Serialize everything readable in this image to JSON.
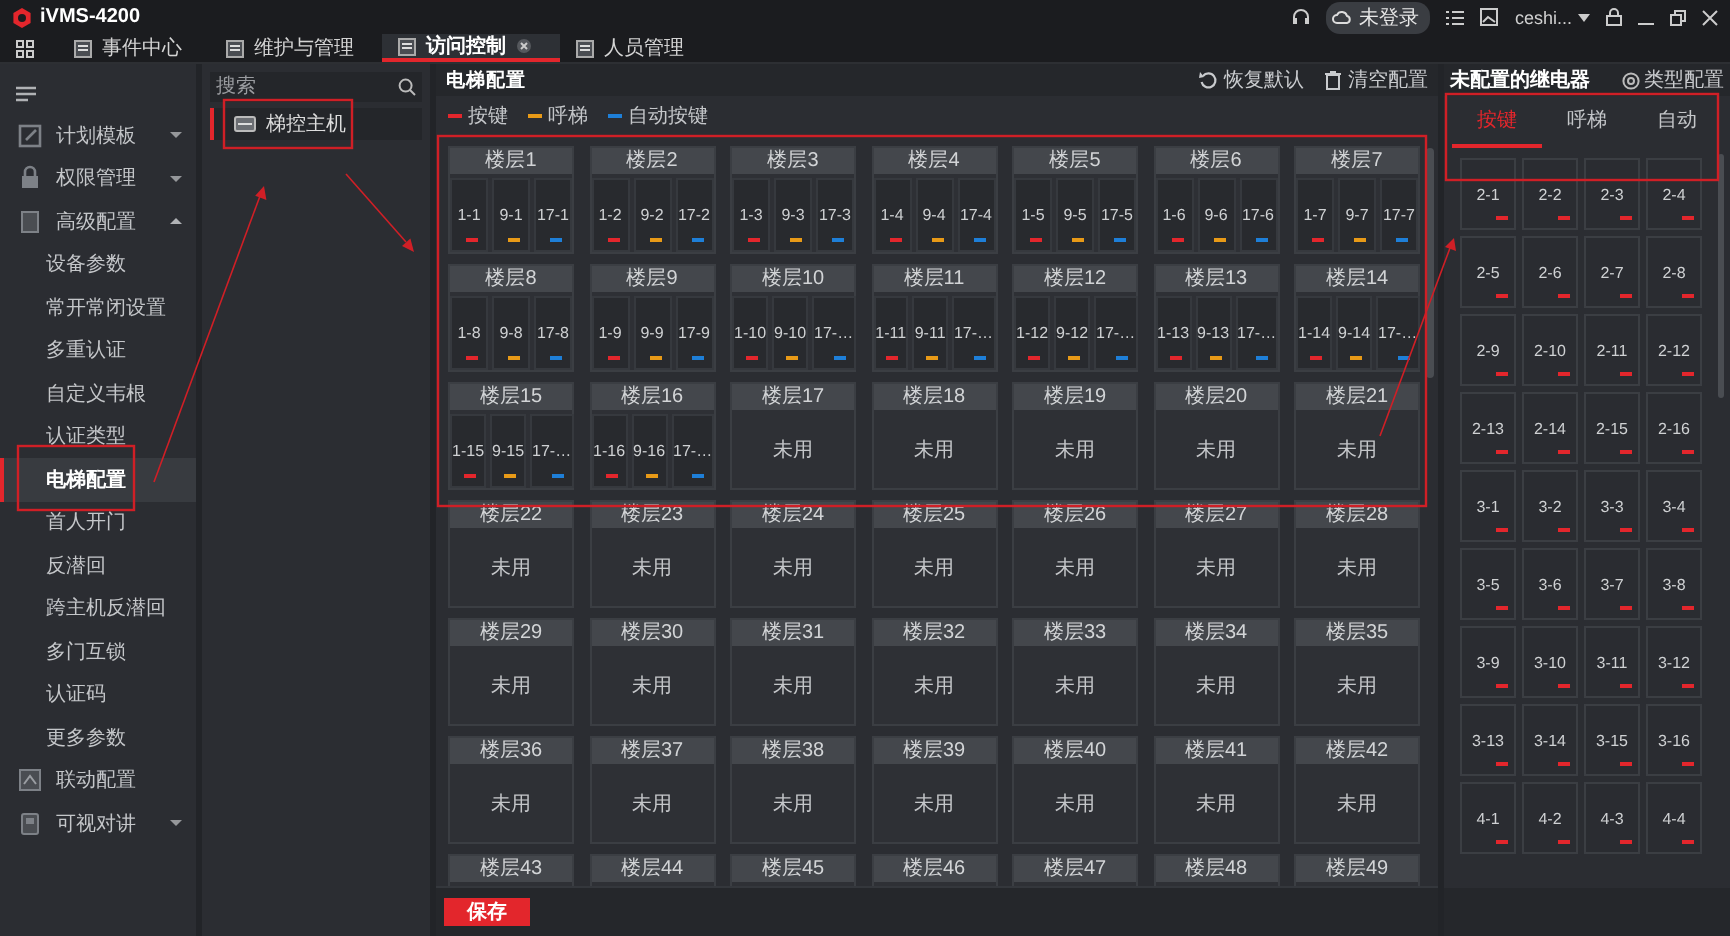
{
  "app": {
    "title": "iVMS-4200"
  },
  "title_bar": {
    "login_status": "未登录",
    "user": "ceshi..."
  },
  "nav_tabs": [
    {
      "label": "事件中心",
      "selected": false,
      "closable": false
    },
    {
      "label": "维护与管理",
      "selected": false,
      "closable": false
    },
    {
      "label": "访问控制",
      "selected": true,
      "closable": true
    },
    {
      "label": "人员管理",
      "selected": false,
      "closable": false
    }
  ],
  "sidebar": {
    "items": [
      {
        "label": "计划模板",
        "expanded": false
      },
      {
        "label": "权限管理",
        "expanded": false
      },
      {
        "label": "高级配置",
        "expanded": true,
        "children": [
          {
            "label": "设备参数",
            "selected": false
          },
          {
            "label": "常开常闭设置",
            "selected": false
          },
          {
            "label": "多重认证",
            "selected": false
          },
          {
            "label": "自定义韦根",
            "selected": false
          },
          {
            "label": "认证类型",
            "selected": false
          },
          {
            "label": "电梯配置",
            "selected": true
          },
          {
            "label": "首人开门",
            "selected": false
          },
          {
            "label": "反潜回",
            "selected": false
          },
          {
            "label": "跨主机反潜回",
            "selected": false
          },
          {
            "label": "多门互锁",
            "selected": false
          },
          {
            "label": "认证码",
            "selected": false
          },
          {
            "label": "更多参数",
            "selected": false
          }
        ]
      },
      {
        "label": "联动配置"
      },
      {
        "label": "可视对讲",
        "expanded": false
      }
    ]
  },
  "device_panel": {
    "search": {
      "placeholder": "搜索"
    },
    "devices": [
      {
        "label": "梯控主机",
        "selected": true
      }
    ]
  },
  "main": {
    "title": "电梯配置",
    "actions": [
      {
        "label": "恢复默认",
        "kind": "reset"
      },
      {
        "label": "清空配置",
        "kind": "clear"
      }
    ],
    "legend": [
      {
        "label": "按键",
        "color": "#e3262c"
      },
      {
        "label": "呼梯",
        "color": "#e89a17"
      },
      {
        "label": "自动按键",
        "color": "#1e7fd8"
      }
    ],
    "floors": [
      {
        "label": "楼层1",
        "units": [
          {
            "label": "1-1",
            "color": "#e3262c"
          },
          {
            "label": "9-1",
            "color": "#e89a17"
          },
          {
            "label": "17-1",
            "color": "#1e7fd8"
          }
        ]
      },
      {
        "label": "楼层2",
        "units": [
          {
            "label": "1-2",
            "color": "#e3262c"
          },
          {
            "label": "9-2",
            "color": "#e89a17"
          },
          {
            "label": "17-2",
            "color": "#1e7fd8"
          }
        ]
      },
      {
        "label": "楼层3",
        "units": [
          {
            "label": "1-3",
            "color": "#e3262c"
          },
          {
            "label": "9-3",
            "color": "#e89a17"
          },
          {
            "label": "17-3",
            "color": "#1e7fd8"
          }
        ]
      },
      {
        "label": "楼层4",
        "units": [
          {
            "label": "1-4",
            "color": "#e3262c"
          },
          {
            "label": "9-4",
            "color": "#e89a17"
          },
          {
            "label": "17-4",
            "color": "#1e7fd8"
          }
        ]
      },
      {
        "label": "楼层5",
        "units": [
          {
            "label": "1-5",
            "color": "#e3262c"
          },
          {
            "label": "9-5",
            "color": "#e89a17"
          },
          {
            "label": "17-5",
            "color": "#1e7fd8"
          }
        ]
      },
      {
        "label": "楼层6",
        "units": [
          {
            "label": "1-6",
            "color": "#e3262c"
          },
          {
            "label": "9-6",
            "color": "#e89a17"
          },
          {
            "label": "17-6",
            "color": "#1e7fd8"
          }
        ]
      },
      {
        "label": "楼层7",
        "units": [
          {
            "label": "1-7",
            "color": "#e3262c"
          },
          {
            "label": "9-7",
            "color": "#e89a17"
          },
          {
            "label": "17-7",
            "color": "#1e7fd8"
          }
        ]
      },
      {
        "label": "楼层8",
        "units": [
          {
            "label": "1-8",
            "color": "#e3262c"
          },
          {
            "label": "9-8",
            "color": "#e89a17"
          },
          {
            "label": "17-8",
            "color": "#1e7fd8"
          }
        ]
      },
      {
        "label": "楼层9",
        "units": [
          {
            "label": "1-9",
            "color": "#e3262c"
          },
          {
            "label": "9-9",
            "color": "#e89a17"
          },
          {
            "label": "17-9",
            "color": "#1e7fd8"
          }
        ]
      },
      {
        "label": "楼层10",
        "units": [
          {
            "label": "1-10",
            "color": "#e3262c"
          },
          {
            "label": "9-10",
            "color": "#e89a17"
          },
          {
            "label": "17-…",
            "color": "#1e7fd8"
          }
        ]
      },
      {
        "label": "楼层11",
        "units": [
          {
            "label": "1-11",
            "color": "#e3262c"
          },
          {
            "label": "9-11",
            "color": "#e89a17"
          },
          {
            "label": "17-…",
            "color": "#1e7fd8"
          }
        ]
      },
      {
        "label": "楼层12",
        "units": [
          {
            "label": "1-12",
            "color": "#e3262c"
          },
          {
            "label": "9-12",
            "color": "#e89a17"
          },
          {
            "label": "17-…",
            "color": "#1e7fd8"
          }
        ]
      },
      {
        "label": "楼层13",
        "units": [
          {
            "label": "1-13",
            "color": "#e3262c"
          },
          {
            "label": "9-13",
            "color": "#e89a17"
          },
          {
            "label": "17-…",
            "color": "#1e7fd8"
          }
        ]
      },
      {
        "label": "楼层14",
        "units": [
          {
            "label": "1-14",
            "color": "#e3262c"
          },
          {
            "label": "9-14",
            "color": "#e89a17"
          },
          {
            "label": "17-…",
            "color": "#1e7fd8"
          }
        ]
      },
      {
        "label": "楼层15",
        "units": [
          {
            "label": "1-15",
            "color": "#e3262c"
          },
          {
            "label": "9-15",
            "color": "#e89a17"
          },
          {
            "label": "17-…",
            "color": "#1e7fd8"
          }
        ]
      },
      {
        "label": "楼层16",
        "units": [
          {
            "label": "1-16",
            "color": "#e3262c"
          },
          {
            "label": "9-16",
            "color": "#e89a17"
          },
          {
            "label": "17-…",
            "color": "#1e7fd8"
          }
        ]
      },
      {
        "label": "楼层17",
        "status": "未用"
      },
      {
        "label": "楼层18",
        "status": "未用"
      },
      {
        "label": "楼层19",
        "status": "未用"
      },
      {
        "label": "楼层20",
        "status": "未用"
      },
      {
        "label": "楼层21",
        "status": "未用"
      },
      {
        "label": "楼层22",
        "status": "未用"
      },
      {
        "label": "楼层23",
        "status": "未用"
      },
      {
        "label": "楼层24",
        "status": "未用"
      },
      {
        "label": "楼层25",
        "status": "未用"
      },
      {
        "label": "楼层26",
        "status": "未用"
      },
      {
        "label": "楼层27",
        "status": "未用"
      },
      {
        "label": "楼层28",
        "status": "未用"
      },
      {
        "label": "楼层29",
        "status": "未用"
      },
      {
        "label": "楼层30",
        "status": "未用"
      },
      {
        "label": "楼层31",
        "status": "未用"
      },
      {
        "label": "楼层32",
        "status": "未用"
      },
      {
        "label": "楼层33",
        "status": "未用"
      },
      {
        "label": "楼层34",
        "status": "未用"
      },
      {
        "label": "楼层35",
        "status": "未用"
      },
      {
        "label": "楼层36",
        "status": "未用"
      },
      {
        "label": "楼层37",
        "status": "未用"
      },
      {
        "label": "楼层38",
        "status": "未用"
      },
      {
        "label": "楼层39",
        "status": "未用"
      },
      {
        "label": "楼层40",
        "status": "未用"
      },
      {
        "label": "楼层41",
        "status": "未用"
      },
      {
        "label": "楼层42",
        "status": "未用"
      },
      {
        "label": "楼层43"
      },
      {
        "label": "楼层44"
      },
      {
        "label": "楼层45"
      },
      {
        "label": "楼层46"
      },
      {
        "label": "楼层47"
      },
      {
        "label": "楼层48"
      },
      {
        "label": "楼层49"
      }
    ],
    "save_button": "保存"
  },
  "right_panel": {
    "title": "未配置的继电器",
    "config_button": "类型配置",
    "tabs": [
      {
        "label": "按键",
        "selected": true
      },
      {
        "label": "呼梯",
        "selected": false
      },
      {
        "label": "自动",
        "selected": false
      }
    ],
    "relays": [
      {
        "label": "2-1",
        "color": "#e3262c"
      },
      {
        "label": "2-2",
        "color": "#e3262c"
      },
      {
        "label": "2-3",
        "color": "#e3262c"
      },
      {
        "label": "2-4",
        "color": "#e3262c"
      },
      {
        "label": "2-5",
        "color": "#e3262c"
      },
      {
        "label": "2-6",
        "color": "#e3262c"
      },
      {
        "label": "2-7",
        "color": "#e3262c"
      },
      {
        "label": "2-8",
        "color": "#e3262c"
      },
      {
        "label": "2-9",
        "color": "#e3262c"
      },
      {
        "label": "2-10",
        "color": "#e3262c"
      },
      {
        "label": "2-11",
        "color": "#e3262c"
      },
      {
        "label": "2-12",
        "color": "#e3262c"
      },
      {
        "label": "2-13",
        "color": "#e3262c"
      },
      {
        "label": "2-14",
        "color": "#e3262c"
      },
      {
        "label": "2-15",
        "color": "#e3262c"
      },
      {
        "label": "2-16",
        "color": "#e3262c"
      },
      {
        "label": "3-1",
        "color": "#e3262c"
      },
      {
        "label": "3-2",
        "color": "#e3262c"
      },
      {
        "label": "3-3",
        "color": "#e3262c"
      },
      {
        "label": "3-4",
        "color": "#e3262c"
      },
      {
        "label": "3-5",
        "color": "#e3262c"
      },
      {
        "label": "3-6",
        "color": "#e3262c"
      },
      {
        "label": "3-7",
        "color": "#e3262c"
      },
      {
        "label": "3-8",
        "color": "#e3262c"
      },
      {
        "label": "3-9",
        "color": "#e3262c"
      },
      {
        "label": "3-10",
        "color": "#e3262c"
      },
      {
        "label": "3-11",
        "color": "#e3262c"
      },
      {
        "label": "3-12",
        "color": "#e3262c"
      },
      {
        "label": "3-13",
        "color": "#e3262c"
      },
      {
        "label": "3-14",
        "color": "#e3262c"
      },
      {
        "label": "3-15",
        "color": "#e3262c"
      },
      {
        "label": "3-16",
        "color": "#e3262c"
      },
      {
        "label": "4-1",
        "color": "#e3262c"
      },
      {
        "label": "4-2",
        "color": "#e3262c"
      },
      {
        "label": "4-3",
        "color": "#e3262c"
      },
      {
        "label": "4-4",
        "color": "#e3262c"
      }
    ]
  }
}
